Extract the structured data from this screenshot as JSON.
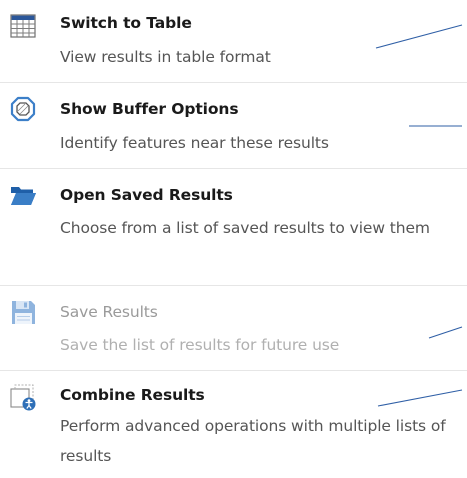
{
  "items": [
    {
      "title": "Switch to Table",
      "description": "View results in table format",
      "icon": "table-icon",
      "enabled": true
    },
    {
      "title": "Show Buffer Options",
      "description": "Identify features near these results",
      "icon": "buffer-icon",
      "enabled": true
    },
    {
      "title": "Open Saved Results",
      "description": "Choose from a list of saved results to view them",
      "icon": "folder-open-icon",
      "enabled": true
    },
    {
      "title": "Save Results",
      "description": "Save the list of results for future use",
      "icon": "floppy-disk-icon",
      "enabled": false
    },
    {
      "title": "Combine Results",
      "description": "Perform advanced operations with multiple lists of results",
      "icon": "combine-results-icon",
      "enabled": true
    }
  ],
  "colors": {
    "table_header": "#2b579a",
    "buffer_ring": "#3c7fc8",
    "folder": "#2e6fb7",
    "floppy_disabled": "#8fb4de",
    "combine_badge": "#2e6fb7",
    "leader_line": "#2f5fa6",
    "divider": "#e6e6e6"
  }
}
